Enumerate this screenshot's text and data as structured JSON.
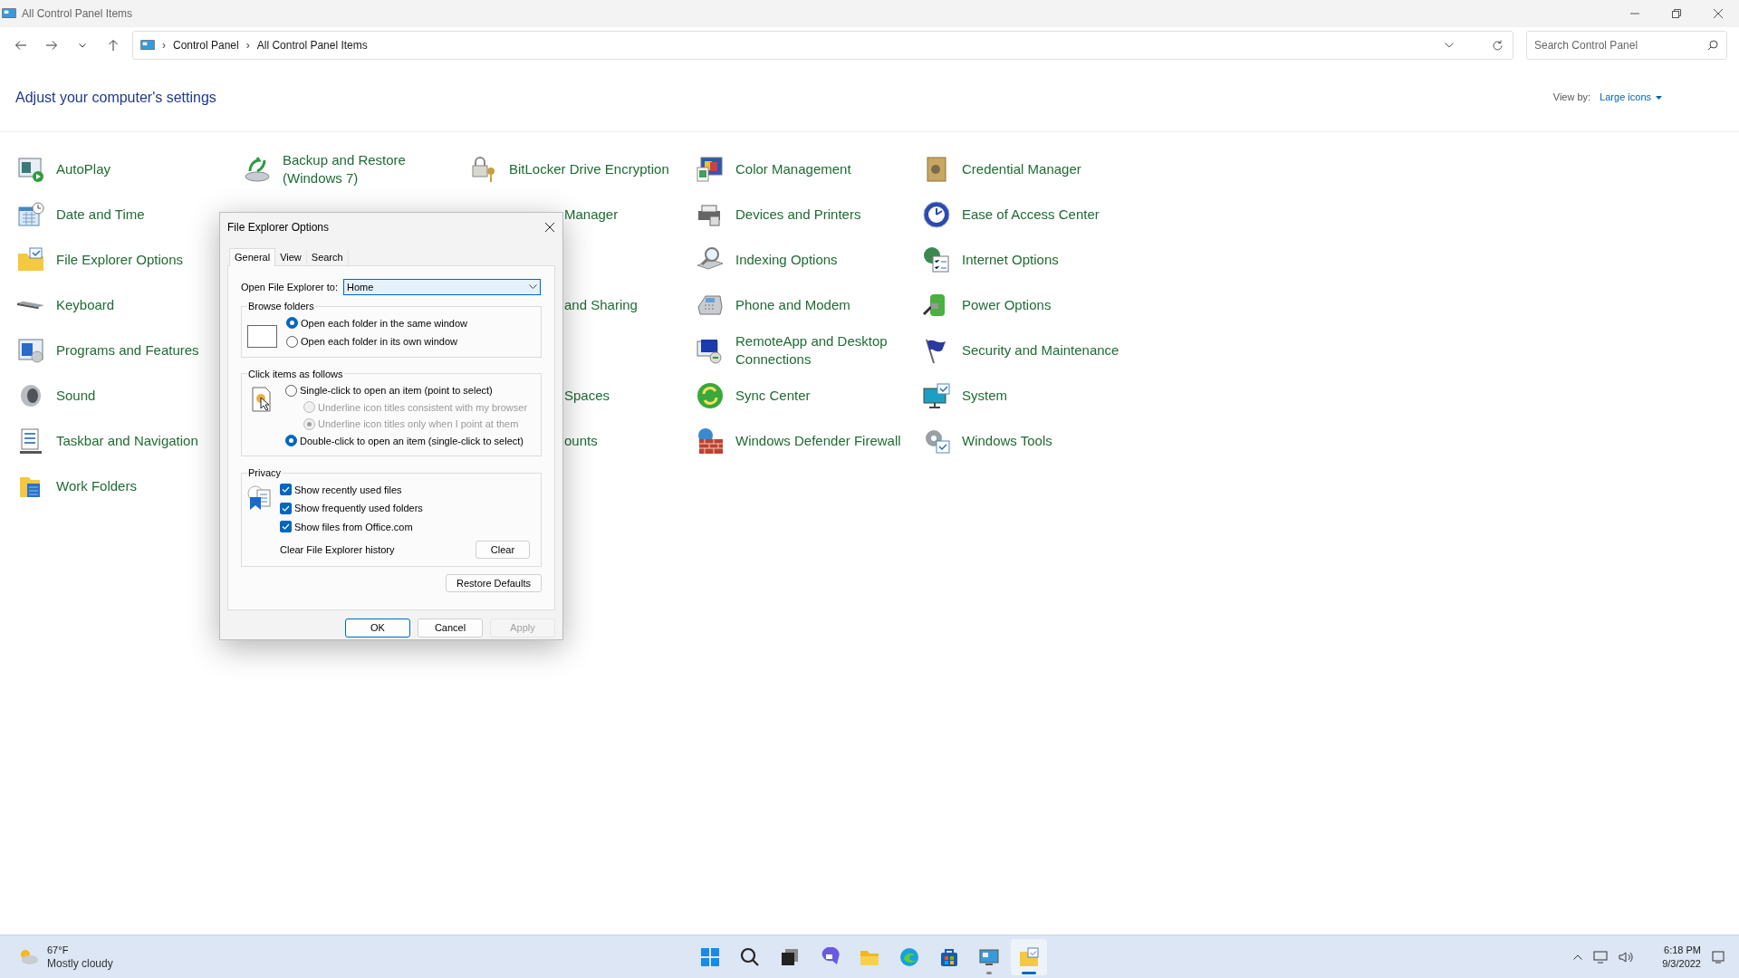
{
  "window": {
    "title": "All Control Panel Items"
  },
  "address_bar": {
    "crumbs": [
      "Control Panel",
      "All Control Panel Items"
    ],
    "separator": "›"
  },
  "search": {
    "placeholder": "Search Control Panel"
  },
  "header": {
    "title": "Adjust your computer's settings",
    "view_by_label": "View by:",
    "view_by_value": "Large icons"
  },
  "columns": [
    {
      "items": [
        {
          "label": "AutoPlay",
          "kind": "full"
        },
        {
          "label": "Date and Time",
          "kind": "full"
        },
        {
          "label": "File Explorer Options",
          "kind": "full"
        },
        {
          "label": "Keyboard",
          "kind": "full"
        },
        {
          "label": "Programs and Features",
          "kind": "full"
        },
        {
          "label": "Sound",
          "kind": "full"
        },
        {
          "label": "Taskbar and Navigation",
          "kind": "full"
        },
        {
          "label": "Work Folders",
          "kind": "full"
        }
      ]
    },
    {
      "items": [
        {
          "label": "Backup and Restore (Windows 7)",
          "kind": "full"
        }
      ]
    },
    {
      "items": [
        {
          "label": "BitLocker Drive Encryption",
          "kind": "full"
        },
        {
          "label": "Manager",
          "kind": "clipped"
        },
        {
          "label": "and Sharing",
          "kind": "clipped"
        },
        {
          "label": "Spaces",
          "kind": "clipped"
        },
        {
          "label": "ounts",
          "kind": "clipped"
        }
      ]
    },
    {
      "items": [
        {
          "label": "Color Management",
          "kind": "full"
        },
        {
          "label": "Devices and Printers",
          "kind": "full"
        },
        {
          "label": "Indexing Options",
          "kind": "full"
        },
        {
          "label": "Phone and Modem",
          "kind": "full"
        },
        {
          "label": "RemoteApp and Desktop Connections",
          "kind": "full"
        },
        {
          "label": "Sync Center",
          "kind": "full"
        },
        {
          "label": "Windows Defender Firewall",
          "kind": "full"
        }
      ]
    },
    {
      "items": [
        {
          "label": "Credential Manager",
          "kind": "full"
        },
        {
          "label": "Ease of Access Center",
          "kind": "full"
        },
        {
          "label": "Internet Options",
          "kind": "full"
        },
        {
          "label": "Power Options",
          "kind": "full"
        },
        {
          "label": "Security and Maintenance",
          "kind": "full"
        },
        {
          "label": "System",
          "kind": "full"
        },
        {
          "label": "Windows Tools",
          "kind": "full"
        }
      ]
    }
  ],
  "dialog": {
    "title": "File Explorer Options",
    "tabs": [
      {
        "label": "General",
        "selected": true
      },
      {
        "label": "View",
        "selected": false
      },
      {
        "label": "Search",
        "selected": false
      }
    ],
    "open_to": {
      "label": "Open File Explorer to:",
      "value": "Home"
    },
    "browse_folders": {
      "title": "Browse folders",
      "options": [
        {
          "label": "Open each folder in the same window",
          "selected": true
        },
        {
          "label": "Open each folder in its own window",
          "selected": false
        }
      ]
    },
    "click_items": {
      "title": "Click items as follows",
      "options": [
        {
          "label": "Single-click to open an item (point to select)",
          "kind": "main",
          "selected": false,
          "disabled": false
        },
        {
          "label": "Underline icon titles consistent with my browser",
          "kind": "sub",
          "selected": false,
          "disabled": true
        },
        {
          "label": "Underline icon titles only when I point at them",
          "kind": "sub",
          "selected": true,
          "disabled": true
        },
        {
          "label": "Double-click to open an item (single-click to select)",
          "kind": "main",
          "selected": true,
          "disabled": false
        }
      ]
    },
    "privacy": {
      "title": "Privacy",
      "options": [
        {
          "label": "Show recently used files",
          "checked": true
        },
        {
          "label": "Show frequently used folders",
          "checked": true
        },
        {
          "label": "Show files from Office.com",
          "checked": true
        }
      ],
      "clear_label": "Clear File Explorer history",
      "clear_button": "Clear"
    },
    "restore_button": "Restore Defaults",
    "buttons": [
      {
        "label": "OK",
        "kind": "default",
        "disabled": false
      },
      {
        "label": "Cancel",
        "kind": "normal",
        "disabled": false
      },
      {
        "label": "Apply",
        "kind": "normal",
        "disabled": true
      }
    ]
  },
  "taskbar": {
    "weather": {
      "temperature": "67°F",
      "condition": "Mostly cloudy"
    },
    "apps": [
      {
        "running": false,
        "focused": false
      },
      {
        "running": false,
        "focused": false
      },
      {
        "running": false,
        "focused": false
      },
      {
        "running": false,
        "focused": false
      },
      {
        "running": false,
        "focused": false
      },
      {
        "running": false,
        "focused": false
      },
      {
        "running": false,
        "focused": false
      },
      {
        "running": true,
        "focused": false
      },
      {
        "running": true,
        "focused": true
      }
    ],
    "time": "6:18 PM",
    "date": "9/3/2022"
  }
}
